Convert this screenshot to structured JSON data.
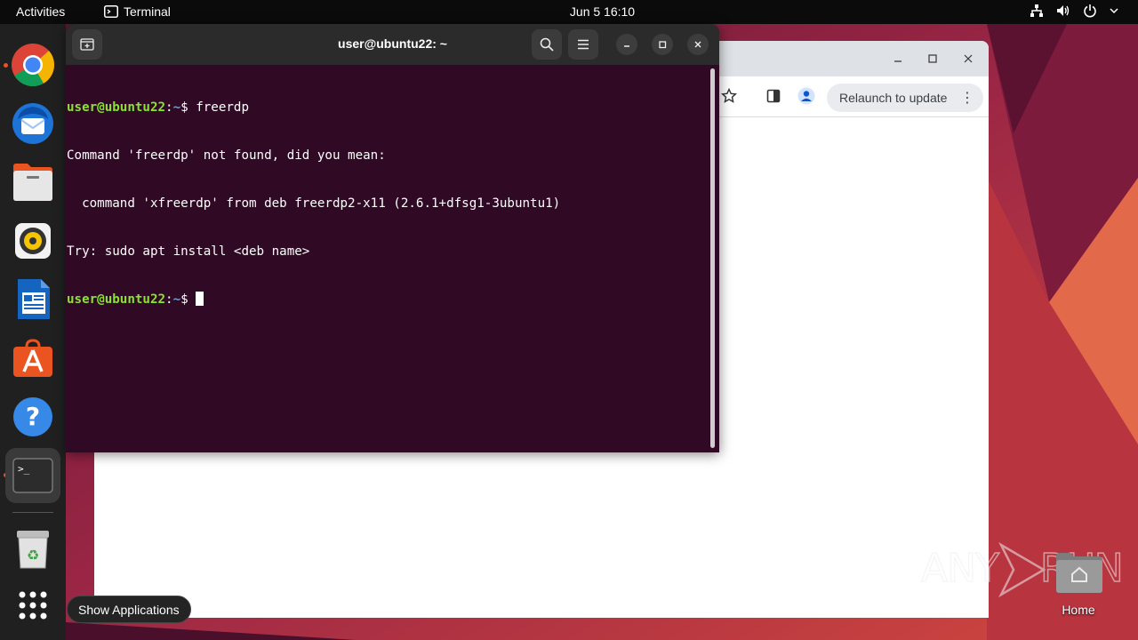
{
  "topbar": {
    "activities": "Activities",
    "app_name": "Terminal",
    "clock": "Jun 5  16:10"
  },
  "dock": {
    "items": [
      {
        "name": "Google Chrome",
        "icon": "chrome-icon",
        "running": true
      },
      {
        "name": "Thunderbird",
        "icon": "thunderbird-icon",
        "running": false
      },
      {
        "name": "Files",
        "icon": "files-icon",
        "running": false
      },
      {
        "name": "Rhythmbox",
        "icon": "rhythmbox-icon",
        "running": false
      },
      {
        "name": "LibreOffice Writer",
        "icon": "writer-icon",
        "running": false
      },
      {
        "name": "Ubuntu Software",
        "icon": "software-icon",
        "running": false
      },
      {
        "name": "Help",
        "icon": "help-icon",
        "running": false
      },
      {
        "name": "Terminal",
        "icon": "terminal-icon",
        "running": true,
        "active": true
      },
      {
        "name": "Trash",
        "icon": "trash-icon",
        "running": false
      },
      {
        "name": "Show Applications",
        "icon": "app-grid-icon",
        "running": false
      }
    ]
  },
  "tooltip": "Show Applications",
  "chrome": {
    "relaunch_label": "Relaunch to update"
  },
  "terminal": {
    "title": "user@ubuntu22: ~",
    "lines": [
      {
        "prompt": "user@ubuntu22",
        "path": "~",
        "cmd": " freerdp"
      },
      {
        "text": "Command 'freerdp' not found, did you mean:"
      },
      {
        "text": "  command 'xfreerdp' from deb freerdp2-x11 (2.6.1+dfsg1-3ubuntu1)"
      },
      {
        "text": "Try: sudo apt install <deb name>"
      },
      {
        "prompt": "user@ubuntu22",
        "path": "~",
        "cmd": " "
      }
    ]
  },
  "desktop": {
    "home_label": "Home"
  },
  "watermark": "ANY RUN",
  "colors": {
    "topbar": "#0b0b0b",
    "dock": "#202020",
    "terminal_bg": "#300a24",
    "terminal_header": "#2b2b2b",
    "prompt_green": "#8ae234",
    "path_blue": "#729fcf",
    "ubuntu_orange": "#e95420"
  }
}
